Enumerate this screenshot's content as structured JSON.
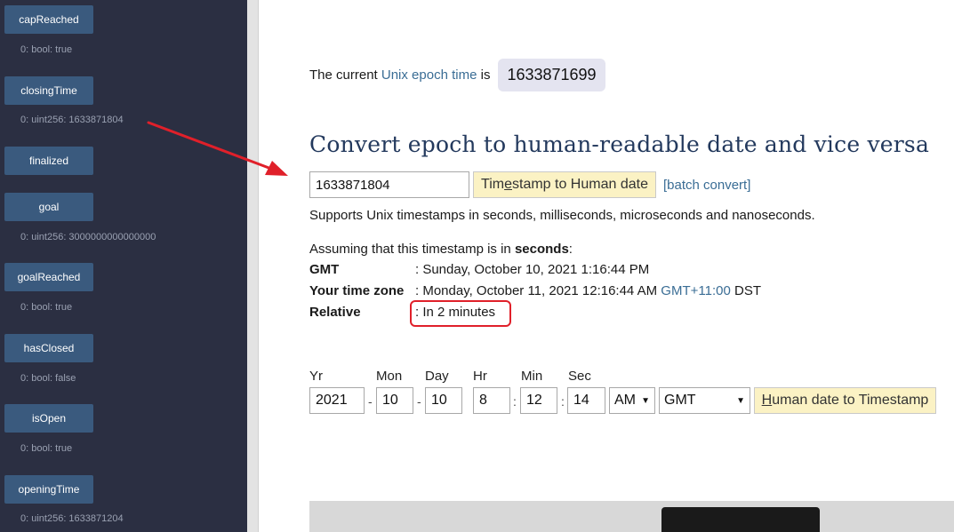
{
  "sidebar": {
    "functions": [
      {
        "name": "capReached",
        "output": "0: bool: true"
      },
      {
        "name": "closingTime",
        "output": "0: uint256: 1633871804"
      },
      {
        "name": "finalized",
        "output": ""
      },
      {
        "name": "goal",
        "output": "0: uint256: 3000000000000000"
      },
      {
        "name": "goalReached",
        "output": "0: bool: true"
      },
      {
        "name": "hasClosed",
        "output": "0: bool: false"
      },
      {
        "name": "isOpen",
        "output": "0: bool: true"
      },
      {
        "name": "openingTime",
        "output": "0: uint256: 1633871204"
      }
    ]
  },
  "main": {
    "epoch_prefix": "The current",
    "epoch_link": "Unix epoch time",
    "epoch_suffix": "is",
    "current_epoch": "1633871699",
    "heading": "Convert epoch to human-readable date and vice versa",
    "timestamp_input": "1633871804",
    "ts_btn_pre": "Tim",
    "ts_btn_ul": "e",
    "ts_btn_post": "stamp to Human date",
    "batch_link": "[batch convert]",
    "supports": "Supports Unix timestamps in seconds, milliseconds, microseconds and nanoseconds.",
    "assume_prefix": "Assuming that this timestamp is in",
    "assume_unit": "seconds",
    "assume_suffix": ":",
    "gmt_label": "GMT",
    "gmt_value": ": Sunday, October 10, 2021 1:16:44 PM",
    "tz_label": "Your time zone",
    "tz_value": ": Monday, October 11, 2021 12:16:44 AM",
    "tz_offset": "GMT+11:00",
    "tz_dst": "DST",
    "relative_label": "Relative",
    "relative_value": ": In 2 minutes"
  },
  "datetime": {
    "labels": {
      "yr": "Yr",
      "mon": "Mon",
      "day": "Day",
      "hr": "Hr",
      "min": "Min",
      "sec": "Sec"
    },
    "values": {
      "yr": "2021",
      "mon": "10",
      "day": "10",
      "hr": "8",
      "min": "12",
      "sec": "14"
    },
    "dash": "-",
    "colon": ":",
    "ampm": "AM",
    "timezone": "GMT",
    "h2ts_ul": "H",
    "h2ts_rest": "uman date to Timestamp"
  },
  "colors": {
    "sidebar_bg": "#2b2f42",
    "fn_button": "#3a5a7e",
    "link": "#3a6d95",
    "heading": "#23395d",
    "yellow_button": "#fbf2c4",
    "annotation_red": "#e0202a"
  },
  "icons": {
    "select_caret": "caret-down-icon",
    "annotation": "red-arrow-icon"
  }
}
